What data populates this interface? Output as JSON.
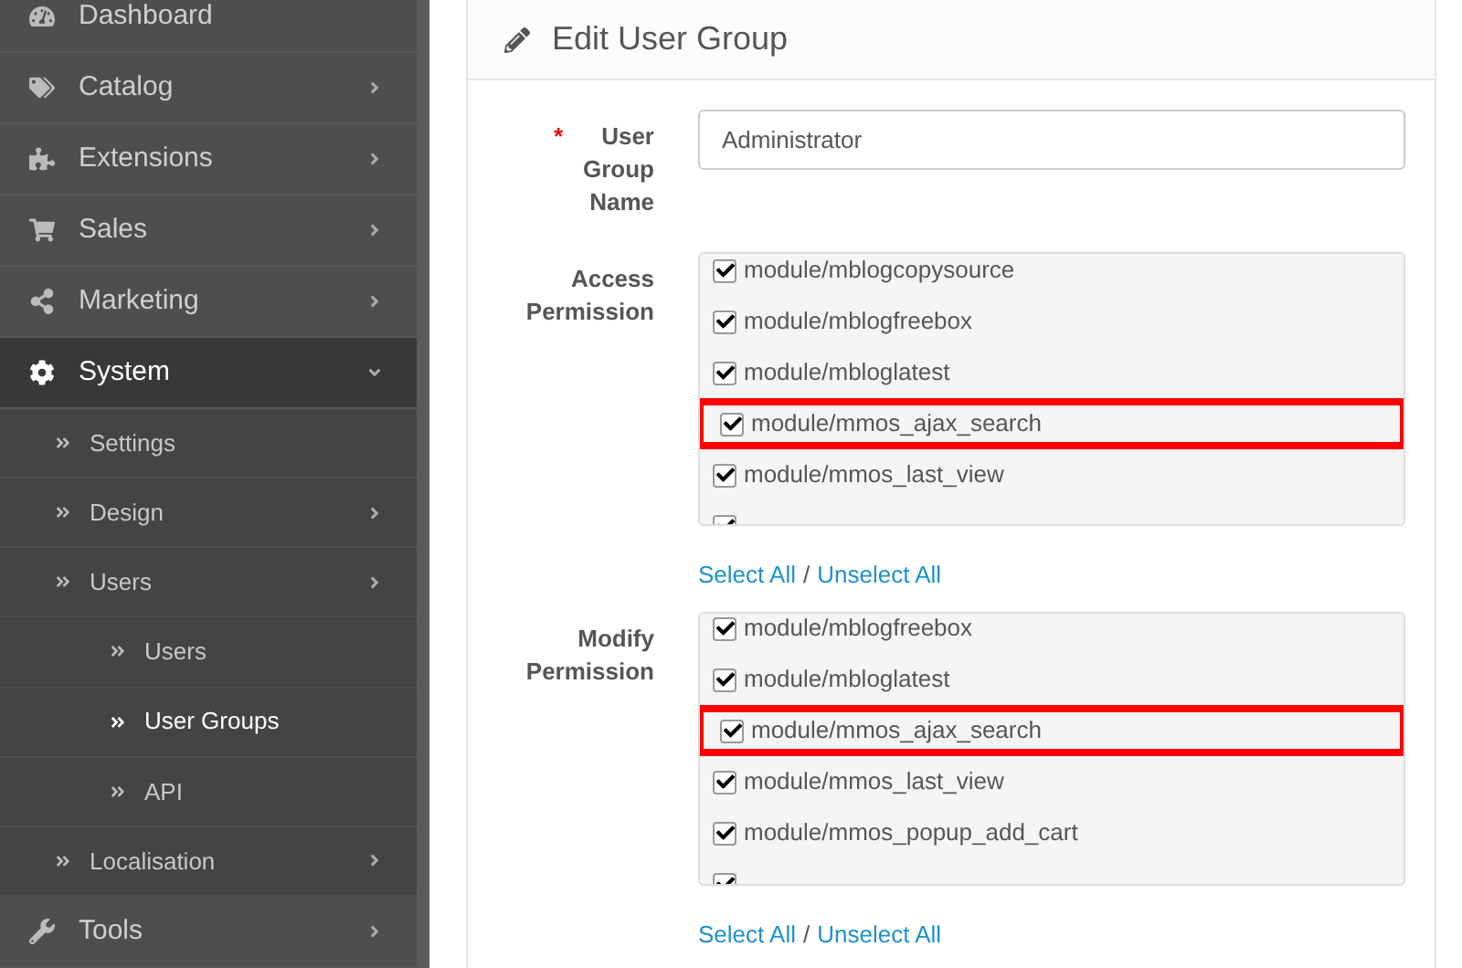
{
  "sidebar": {
    "items": [
      {
        "label": "Dashboard"
      },
      {
        "label": "Catalog",
        "expanded": false
      },
      {
        "label": "Extensions",
        "expanded": false
      },
      {
        "label": "Sales",
        "expanded": false
      },
      {
        "label": "Marketing",
        "expanded": false
      },
      {
        "label": "System",
        "expanded": true,
        "children": [
          {
            "label": "Settings"
          },
          {
            "label": "Design",
            "expanded": false
          },
          {
            "label": "Users",
            "expanded": false,
            "children": [
              {
                "label": "Users",
                "selected": false
              },
              {
                "label": "User Groups",
                "selected": true
              },
              {
                "label": "API",
                "selected": false
              }
            ]
          },
          {
            "label": "Localisation",
            "expanded": false
          }
        ]
      },
      {
        "label": "Tools",
        "expanded": false
      }
    ]
  },
  "panel": {
    "title": "Edit User Group",
    "fields": [
      {
        "kind": "text",
        "label": "User Group Name",
        "required": true,
        "required_mark": "*",
        "value": "Administrator"
      },
      {
        "kind": "checklist",
        "label": "Access Permission",
        "items": [
          {
            "label": "module/mblogcopysource",
            "checked": true,
            "highlighted": false
          },
          {
            "label": "module/mblogfreebox",
            "checked": true,
            "highlighted": false
          },
          {
            "label": "module/mbloglatest",
            "checked": true,
            "highlighted": false
          },
          {
            "label": "module/mmos_ajax_search",
            "checked": true,
            "highlighted": true
          },
          {
            "label": "module/mmos_last_view",
            "checked": true,
            "highlighted": false
          },
          {
            "checked": true,
            "highlighted": false
          }
        ],
        "select_all": "Select All",
        "separator": "/",
        "unselect_all": "Unselect All"
      },
      {
        "kind": "checklist",
        "label": "Modify Permission",
        "items": [
          {
            "label": "module/mblogfreebox",
            "checked": true,
            "highlighted": false
          },
          {
            "label": "module/mbloglatest",
            "checked": true,
            "highlighted": false
          },
          {
            "label": "module/mmos_ajax_search",
            "checked": true,
            "highlighted": true
          },
          {
            "label": "module/mmos_last_view",
            "checked": true,
            "highlighted": false
          },
          {
            "label": "module/mmos_popup_add_cart",
            "checked": true,
            "highlighted": false
          },
          {
            "checked": true,
            "highlighted": false
          }
        ],
        "select_all": "Select All",
        "separator": "/",
        "unselect_all": "Unselect All"
      }
    ]
  }
}
